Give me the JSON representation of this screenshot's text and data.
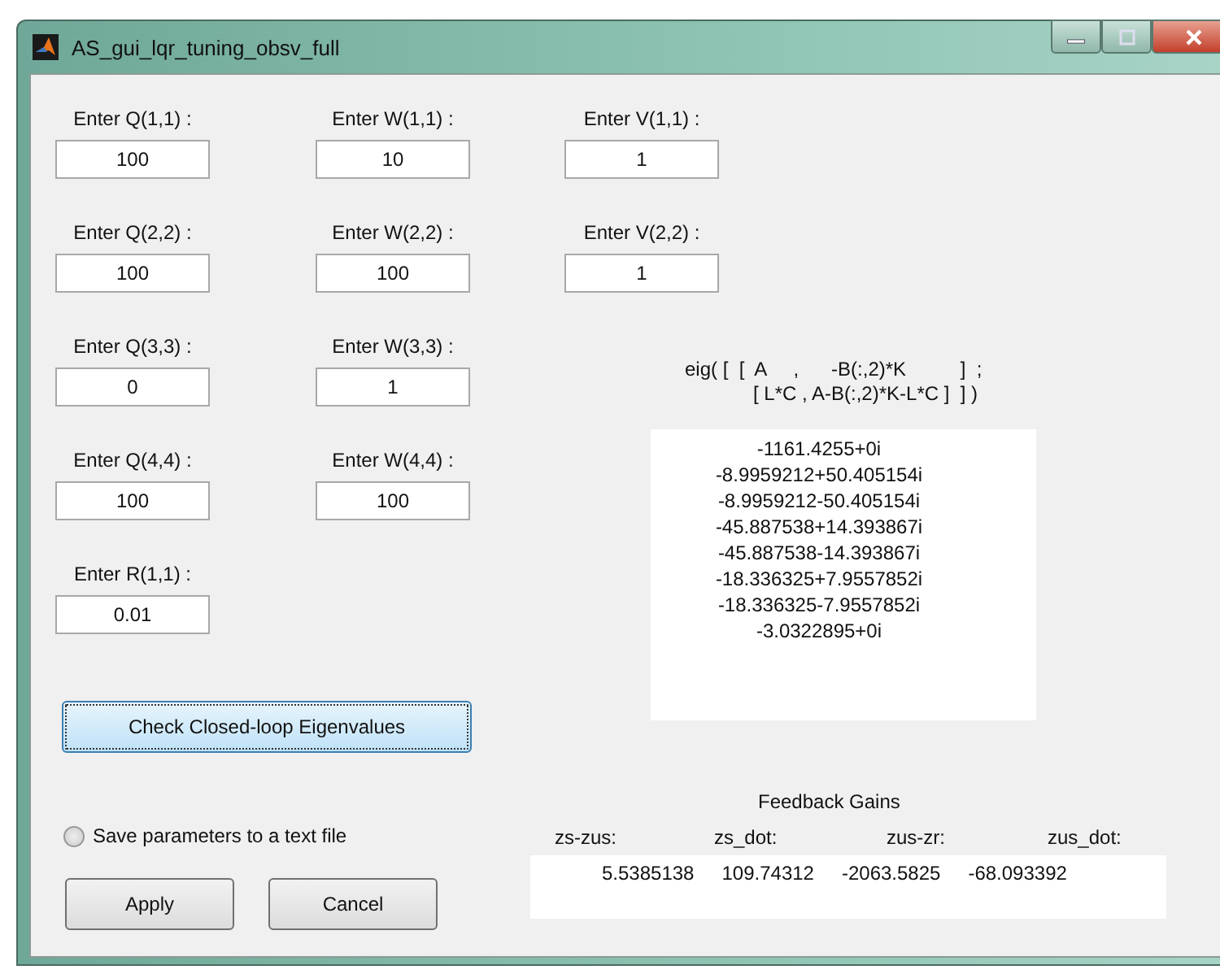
{
  "window": {
    "title": "AS_gui_lqr_tuning_obsv_full"
  },
  "weights": [
    {
      "label": "Enter Q(1,1) :",
      "value": "100"
    },
    {
      "label": "Enter W(1,1) :",
      "value": "10"
    },
    {
      "label": "Enter Q(2,2) :",
      "value": "100"
    },
    {
      "label": "Enter W(2,2) :",
      "value": "100"
    },
    {
      "label": "Enter Q(3,3) :",
      "value": "0"
    },
    {
      "label": "Enter W(3,3) :",
      "value": "1"
    },
    {
      "label": "Enter Q(4,4) :",
      "value": "100"
    },
    {
      "label": "Enter W(4,4) :",
      "value": "100"
    },
    {
      "label": "Enter R(1,1) :",
      "value": "0.01"
    }
  ],
  "noise": [
    {
      "label": "Enter V(1,1) :",
      "value": "1"
    },
    {
      "label": "Enter V(2,2) :",
      "value": "1"
    }
  ],
  "check_button": "Check Closed-loop Eigenvalues",
  "save_option": {
    "label": "Save parameters to a text file",
    "checked": false
  },
  "buttons": [
    "Apply",
    "Cancel"
  ],
  "eigen": {
    "expression": [
      "eig( [  [  A     ,      -B(:,2)*K          ]  ;",
      "[ L*C , A-B(:,2)*K-L*C ]  ] )"
    ],
    "values": [
      "-1161.4255+0i",
      "-8.9959212+50.405154i",
      "-8.9959212-50.405154i",
      "-45.887538+14.393867i",
      "-45.887538-14.393867i",
      "-18.336325+7.9557852i",
      "-18.336325-7.9557852i",
      "-3.0322895+0i"
    ]
  },
  "feedback_gains": {
    "title": "Feedback Gains",
    "columns": [
      "zs-zus:",
      "zs_dot:",
      "zus-zr:",
      "zus_dot:"
    ],
    "values": [
      "5.5385138",
      "109.74312",
      "-2063.5825",
      "-68.093392"
    ]
  }
}
